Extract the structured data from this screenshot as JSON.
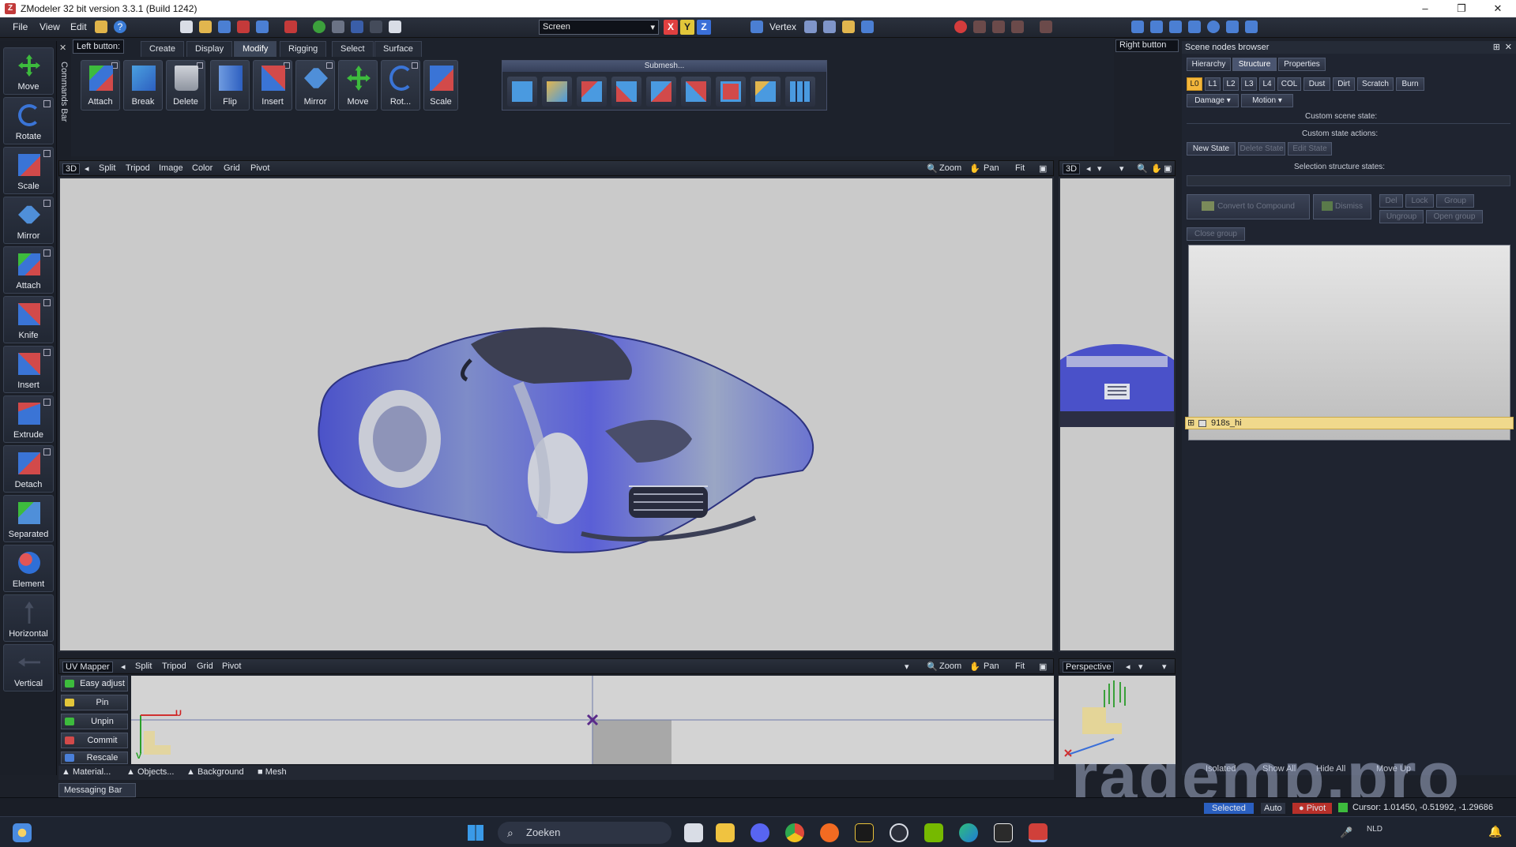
{
  "window": {
    "title": "ZModeler 32 bit version 3.3.1 (Build 1242)",
    "app_badge": "Z",
    "minimize": "–",
    "maximize": "❐",
    "close": "✕"
  },
  "menu": {
    "file": "File",
    "view": "View",
    "edit": "Edit",
    "screen_select": "Screen",
    "axis_x": "X",
    "axis_y": "Y",
    "axis_z": "Z",
    "mode_select": "Vertex"
  },
  "left_button_label": "Left button:",
  "right_button_label": "Right button",
  "commands_bar_label": "Commands Bar",
  "tools": [
    {
      "label": "Move",
      "color": "#3dbb3d"
    },
    {
      "label": "Rotate",
      "color": "#3a74d6"
    },
    {
      "label": "Scale",
      "color": "#3a74d6"
    },
    {
      "label": "Mirror",
      "color": "#4f8fd9"
    },
    {
      "label": "Attach",
      "color": "#d24a4a"
    },
    {
      "label": "Knife",
      "color": "#6d8fd0"
    },
    {
      "label": "Insert",
      "color": "#d24a4a"
    },
    {
      "label": "Extrude",
      "color": "#3a74d6"
    },
    {
      "label": "Detach",
      "color": "#d24a4a"
    },
    {
      "label": "Separated",
      "color": "#4f8fd9"
    },
    {
      "label": "Element",
      "color": "#2f6fd6"
    },
    {
      "label": "Horizontal",
      "color": "#5b6478"
    },
    {
      "label": "Vertical",
      "color": "#5b6478"
    }
  ],
  "ribbon": {
    "tabs": [
      "Create",
      "Display",
      "Modify",
      "Rigging",
      "Select",
      "Surface"
    ],
    "active_tab": "Modify",
    "buttons": [
      "Attach",
      "Break",
      "Delete",
      "Flip",
      "Insert",
      "Mirror",
      "Move",
      "Rot...",
      "Scale"
    ],
    "submesh_title": "Submesh..."
  },
  "viewport_main": {
    "mode": "3D",
    "items": [
      "Split",
      "Tripod",
      "Image",
      "Color",
      "Grid",
      "Pivot"
    ],
    "zoom": "Zoom",
    "pan": "Pan",
    "fit": "Fit"
  },
  "viewport_side": {
    "mode": "3D"
  },
  "uv_mapper": {
    "title": "UV Mapper",
    "items": [
      "Split",
      "Tripod",
      "Grid",
      "Pivot"
    ],
    "zoom": "Zoom",
    "pan": "Pan",
    "fit": "Fit",
    "axis_u": "U",
    "axis_v": "V",
    "buttons": [
      "Easy adjust",
      "Pin",
      "Unpin",
      "Commit",
      "Rescale"
    ],
    "bottom_tabs": [
      "Material...",
      "Objects...",
      "Background",
      "Mesh"
    ]
  },
  "perspective": {
    "title": "Perspective"
  },
  "scene_browser": {
    "title": "Scene nodes browser",
    "tabs": [
      "Hierarchy",
      "Structure",
      "Properties"
    ],
    "active_tab": "Structure",
    "lods": [
      "L0",
      "L1",
      "L2",
      "L3",
      "L4",
      "COL",
      "Dust",
      "Dirt",
      "Scratch",
      "Burn"
    ],
    "damage": "Damage",
    "motion": "Motion",
    "custom_scene_state": "Custom scene state:",
    "custom_state_actions": "Custom state actions:",
    "new_state": "New State",
    "delete_state": "Delete State",
    "edit_state": "Edit State",
    "selection_states": "Selection structure states:",
    "convert": "Convert to Compound",
    "dismiss": "Dismiss",
    "del": "Del",
    "lock": "Lock",
    "group": "Group",
    "ungroup": "Ungroup",
    "open_group": "Open group",
    "close_group": "Close group",
    "node_name": "918s_hi",
    "bottom": {
      "isolated": "Isolated",
      "show_all": "Show All",
      "hide_all": "Hide All",
      "move_up": "Move Up"
    }
  },
  "messaging_bar": "Messaging Bar",
  "status": {
    "selected": "Selected",
    "auto": "Auto",
    "pivot": "Pivot",
    "cursor": "Cursor: 1.01450, -0.51992, -1.29686"
  },
  "watermark": "ragemp.pro",
  "taskbar": {
    "search_placeholder": "Zoeken",
    "lang": "NLD"
  }
}
